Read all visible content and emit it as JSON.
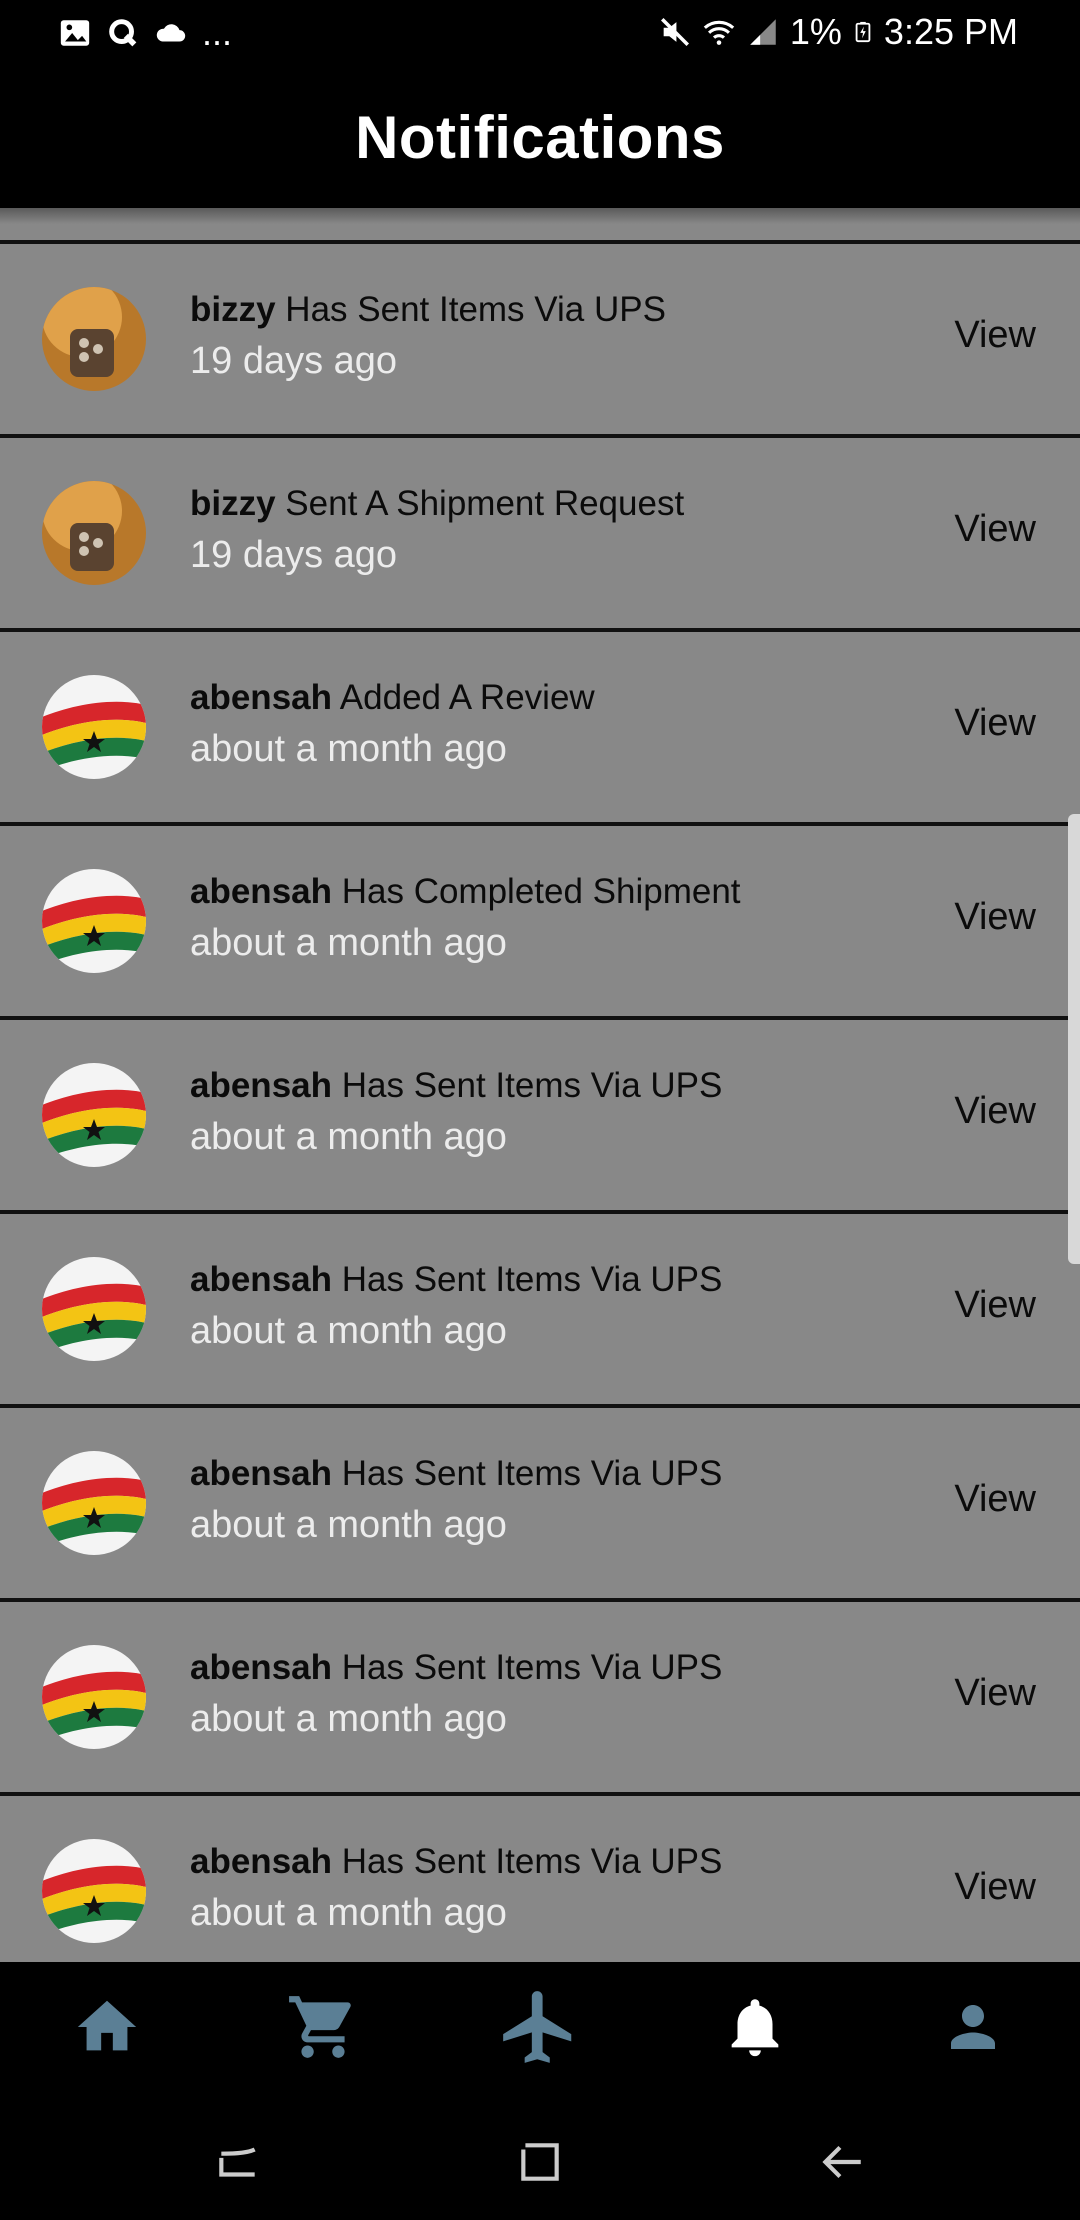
{
  "status_bar": {
    "left_icons": [
      "image-icon",
      "q-icon",
      "cloud-icon"
    ],
    "more": "...",
    "battery_text": "1%",
    "time": "3:25 PM",
    "right_icons": [
      "mute-icon",
      "wifi-icon",
      "signal-icon",
      "battery-icon"
    ]
  },
  "header": {
    "title": "Notifications"
  },
  "notifications": [
    {
      "user": "bizzy",
      "action": " Has Sent Items Via UPS",
      "time": "19 days ago",
      "view_label": "View",
      "avatar": "bizzy"
    },
    {
      "user": "bizzy",
      "action": " Sent A Shipment Request",
      "time": "19 days ago",
      "view_label": "View",
      "avatar": "bizzy"
    },
    {
      "user": "abensah",
      "action": " Added A Review",
      "time": "about a month ago",
      "view_label": "View",
      "avatar": "ghana-flag"
    },
    {
      "user": "abensah",
      "action": " Has Completed Shipment",
      "time": "about a month ago",
      "view_label": "View",
      "avatar": "ghana-flag"
    },
    {
      "user": "abensah",
      "action": " Has Sent Items Via UPS",
      "time": "about a month ago",
      "view_label": "View",
      "avatar": "ghana-flag"
    },
    {
      "user": "abensah",
      "action": " Has Sent Items Via UPS",
      "time": "about a month ago",
      "view_label": "View",
      "avatar": "ghana-flag"
    },
    {
      "user": "abensah",
      "action": " Has Sent Items Via UPS",
      "time": "about a month ago",
      "view_label": "View",
      "avatar": "ghana-flag"
    },
    {
      "user": "abensah",
      "action": " Has Sent Items Via UPS",
      "time": "about a month ago",
      "view_label": "View",
      "avatar": "ghana-flag"
    },
    {
      "user": "abensah",
      "action": " Has Sent Items Via UPS",
      "time": "about a month ago",
      "view_label": "View",
      "avatar": "ghana-flag"
    }
  ],
  "bottom_nav": {
    "items": [
      {
        "icon": "home-icon",
        "active": false
      },
      {
        "icon": "cart-icon",
        "active": false
      },
      {
        "icon": "airplane-icon",
        "active": false
      },
      {
        "icon": "bell-icon",
        "active": true
      },
      {
        "icon": "person-icon",
        "active": false
      }
    ],
    "inactive_color": "#5b7f95",
    "active_color": "#ffffff"
  },
  "system_nav": {
    "icons": [
      "recents-icon",
      "home-square-icon",
      "back-icon"
    ]
  },
  "colors": {
    "list_background": "#888888",
    "divider": "#111111",
    "timestamp": "#ececec"
  }
}
